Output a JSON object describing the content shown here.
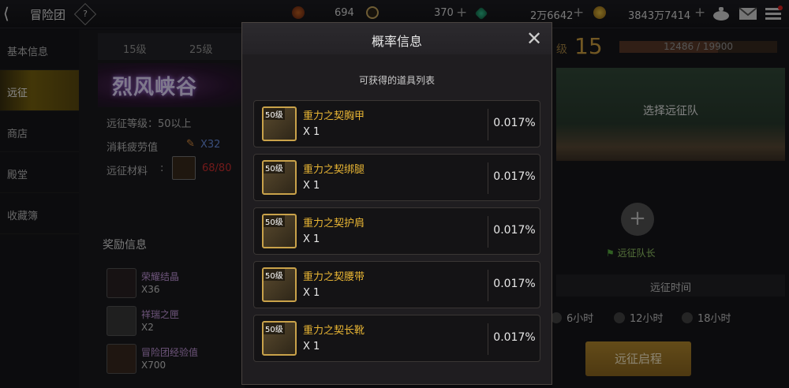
{
  "header": {
    "back_glyph": "⟨",
    "title": "冒险团",
    "help_glyph": "?",
    "resources": [
      {
        "icon": "trophy-icon",
        "value": "694"
      },
      {
        "icon": "coin-icon",
        "value": "370"
      },
      {
        "icon": "gem-icon",
        "value": "2万6642"
      },
      {
        "icon": "gold-icon",
        "value": "3843万7414"
      }
    ],
    "plus": "+"
  },
  "sidebar": {
    "items": [
      {
        "label": "基本信息"
      },
      {
        "label": "远征"
      },
      {
        "label": "商店"
      },
      {
        "label": "殿堂"
      },
      {
        "label": "收藏簿"
      }
    ],
    "active_index": 1
  },
  "middle": {
    "tabs": [
      "15级",
      "25级"
    ],
    "banner_title": "烈风峡谷",
    "level_req": "远征等级：50以上",
    "fatigue_label": "消耗疲劳值",
    "fatigue_value": "X32",
    "material_label": "远征材料",
    "material_value": "68/80",
    "reward_heading": "奖励信息",
    "rewards": [
      {
        "name": "荣耀结晶",
        "qty": "X36"
      },
      {
        "name": "祥瑞之匣",
        "qty": "X2"
      },
      {
        "name": "冒险团经验值",
        "qty": "X700"
      }
    ]
  },
  "right": {
    "level_prefix": "级",
    "level": "15",
    "exp_text": "12486 / 19900",
    "exp_progress": 0.627,
    "scene_text": "选择远征队",
    "add_glyph": "+",
    "leader_label": "远征队长",
    "time_heading": "远征时间",
    "time_options": [
      "6小时",
      "12小时",
      "18小时"
    ],
    "start_button": "远征启程"
  },
  "modal": {
    "title": "概率信息",
    "close_glyph": "✕",
    "subtitle": "可获得的道具列表",
    "items": [
      {
        "badge": "50级",
        "name": "重力之契胸甲",
        "qty": "X 1",
        "prob": "0.017%"
      },
      {
        "badge": "50级",
        "name": "重力之契绑腿",
        "qty": "X 1",
        "prob": "0.017%"
      },
      {
        "badge": "50级",
        "name": "重力之契护肩",
        "qty": "X 1",
        "prob": "0.017%"
      },
      {
        "badge": "50级",
        "name": "重力之契腰带",
        "qty": "X 1",
        "prob": "0.017%"
      },
      {
        "badge": "50级",
        "name": "重力之契长靴",
        "qty": "X 1",
        "prob": "0.017%"
      }
    ]
  },
  "colors": {
    "accent": "#e8b534",
    "reward_name": "#c79adf",
    "material_value": "#d03030",
    "fatigue_value": "#6a8fe0"
  }
}
